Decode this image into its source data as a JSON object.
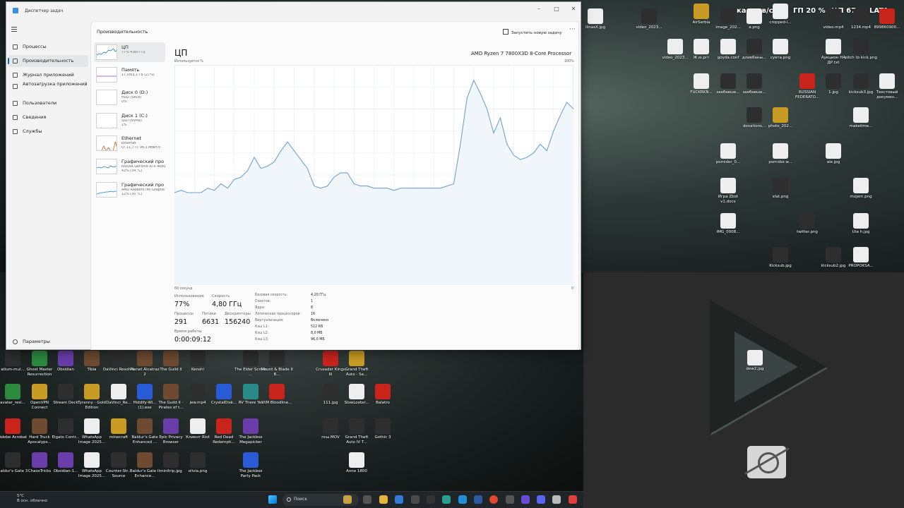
{
  "window": {
    "title": "Диспетчер задач",
    "header": "Производительность",
    "new_task": "Запустить новую задачу",
    "more": "···",
    "minimize": "–",
    "maximize": "□",
    "close": "✕"
  },
  "nav": {
    "items": [
      {
        "label": "Процессы",
        "icon": "processes-icon"
      },
      {
        "label": "Производительность",
        "icon": "performance-icon",
        "selected": true
      },
      {
        "label": "Журнал приложений",
        "icon": "app-history-icon"
      },
      {
        "label": "Автозагрузка приложений",
        "icon": "startup-icon"
      },
      {
        "label": "Пользователи",
        "icon": "users-icon"
      },
      {
        "label": "Сведения",
        "icon": "details-icon"
      },
      {
        "label": "Службы",
        "icon": "services-icon"
      }
    ],
    "settings": "Параметры"
  },
  "devices": [
    {
      "name": "ЦП",
      "line1": "77% 4,80 ГГц",
      "line2": "",
      "selected": true
    },
    {
      "name": "Память",
      "line1": "17,0/63,1 ГБ (27%)",
      "line2": ""
    },
    {
      "name": "Диск 0 (D:)",
      "line1": "HDD (SATA)",
      "line2": "0%"
    },
    {
      "name": "Диск 1 (C:)",
      "line1": "SSD (NVMe)",
      "line2": "1%"
    },
    {
      "name": "Ethernet",
      "line1": "Ethernet",
      "line2": "О: 11,7 П: 98,3 Мбит/с"
    },
    {
      "name": "Графический про",
      "line1": "NVIDIA GeForce RTX 4080",
      "line2": "43% (34 °C)"
    },
    {
      "name": "Графический про",
      "line1": "AMD Radeon(TM) Graphics",
      "line2": "12% (30 °C)"
    }
  ],
  "cpu": {
    "title": "ЦП",
    "name": "AMD Ryzen 7 7800X3D 8-Core Processor",
    "util_label": "Используется %",
    "max_label": "100%",
    "time_label": "60 секунд",
    "zero_label": "0",
    "stats": {
      "usage_label": "Использование",
      "usage": "77%",
      "speed_label": "Скорость",
      "speed": "4,80 ГГц",
      "procs_label": "Процессы",
      "procs": "291",
      "threads_label": "Потоки",
      "threads": "6631",
      "handles_label": "Дескрипторы",
      "handles": "156240",
      "uptime_label": "Время работы",
      "uptime": "0:00:09:12"
    },
    "specs": [
      {
        "k": "Базовая скорость:",
        "v": "4,20 ГГц"
      },
      {
        "k": "Сокетов:",
        "v": "1"
      },
      {
        "k": "Ядра:",
        "v": "8"
      },
      {
        "k": "Логических процессоров:",
        "v": "16"
      },
      {
        "k": "Виртуализация:",
        "v": "Включено"
      },
      {
        "k": "Кэш L1:",
        "v": "512 КБ"
      },
      {
        "k": "Кэш L2:",
        "v": "8,0 МБ"
      },
      {
        "k": "Кэш L3:",
        "v": "96,0 МБ"
      }
    ]
  },
  "chart_data": {
    "type": "area",
    "title": "ЦП",
    "ylabel": "Используется %",
    "xlabel": "60 секунд",
    "ylim": [
      0,
      100
    ],
    "x": [
      60,
      59,
      58,
      57,
      56,
      55,
      54,
      53,
      52,
      51,
      50,
      49,
      48,
      47,
      46,
      45,
      44,
      43,
      42,
      41,
      40,
      39,
      38,
      37,
      36,
      35,
      34,
      33,
      32,
      31,
      30,
      29,
      28,
      27,
      26,
      25,
      24,
      23,
      22,
      21,
      20,
      19,
      18,
      17,
      16,
      15,
      14,
      13,
      12,
      11,
      10,
      9,
      8,
      7,
      6,
      5,
      4,
      3,
      2,
      1,
      0
    ],
    "series": [
      {
        "values": [
          42,
          43,
          42,
          42,
          42,
          44,
          43,
          46,
          44,
          48,
          49,
          52,
          58,
          53,
          54,
          56,
          61,
          65,
          61,
          57,
          53,
          45,
          44,
          45,
          49,
          51,
          51,
          46,
          45,
          45,
          44,
          44,
          44,
          43,
          44,
          44,
          44,
          44,
          44,
          44,
          44,
          45,
          46,
          64,
          85,
          93,
          87,
          80,
          69,
          76,
          64,
          59,
          57,
          58,
          60,
          64,
          61,
          70,
          77,
          83,
          80
        ]
      }
    ]
  },
  "desktop": {
    "tray_top": [
      {
        "text": "кадров/с"
      },
      {
        "text": "ГП 20 %"
      },
      {
        "text": "ЦП 67"
      },
      {
        "text": "LATA"
      }
    ],
    "top_icons": [
      {
        "label": "ilinasX.jpg",
        "color": "white"
      },
      {
        "label": "video_2023...",
        "color": "dark"
      },
      {
        "label": "AirSerbia",
        "color": "gold"
      },
      {
        "label": "image_202...",
        "color": "dark"
      },
      {
        "label": "a.png",
        "color": "white"
      },
      {
        "label": "cropped-i...",
        "color": "white"
      },
      {
        "label": "video.mp4",
        "color": "dark"
      },
      {
        "label": "1234.mp4",
        "color": "dark"
      },
      {
        "label": "899860900...",
        "color": "red"
      },
      {
        "label": "video_2023...",
        "color": "white"
      },
      {
        "label": "Ж.ю.ргг",
        "color": "white"
      },
      {
        "label": "goyda.conf",
        "color": "white"
      },
      {
        "label": "длиебаны...",
        "color": "dark"
      },
      {
        "label": "суета.png",
        "color": "white"
      },
      {
        "label": "Аукцион НА ДР.txt",
        "color": "white"
      },
      {
        "label": "pitch to kick.png",
        "color": "dark"
      },
      {
        "label": "FUCKRKN...",
        "color": "white"
      },
      {
        "label": "заебавше...",
        "color": "dark"
      },
      {
        "label": "заебавше...",
        "color": "dark"
      },
      {
        "label": "RUSSIAN FEDERATO...",
        "color": "red"
      },
      {
        "label": "1.jpg",
        "color": "dark"
      },
      {
        "label": "kicksub3.jpg",
        "color": "dark"
      },
      {
        "label": "Текстовый докумен...",
        "color": "white"
      },
      {
        "label": "donations...",
        "color": "dark"
      },
      {
        "label": "photo_202...",
        "color": "gold"
      },
      {
        "label": "makeitme...",
        "color": "white"
      },
      {
        "label": "pomidor_0...",
        "color": "white"
      },
      {
        "label": "pomidor.w...",
        "color": "white"
      },
      {
        "label": "ale.jpg",
        "color": "white"
      },
      {
        "label": "Игра Zbot v1.docx",
        "color": "white"
      },
      {
        "label": "stat.png",
        "color": "dark"
      },
      {
        "label": "mojem.png",
        "color": "white"
      },
      {
        "label": "IMG_0008...",
        "color": "white"
      },
      {
        "label": "twitter.png",
        "color": "dark"
      },
      {
        "label": "Ute h.jpg",
        "color": "white"
      },
      {
        "label": "Kicksub.jpg",
        "color": "dark"
      },
      {
        "label": "kicksub2.jpg",
        "color": "dark"
      },
      {
        "label": "PROPOKSA...",
        "color": "white"
      }
    ],
    "bottom_icons": [
      {
        "label": "atium-mul...",
        "color": "dark"
      },
      {
        "label": "Ghost Master Resurrection",
        "color": "green"
      },
      {
        "label": "Obsidian",
        "color": "purple"
      },
      {
        "label": "Tibia",
        "color": "brown"
      },
      {
        "label": "DaVinci Resolve",
        "color": "dark"
      },
      {
        "label": "Planet Alcatraz 2",
        "color": "brown"
      },
      {
        "label": "The Guild II",
        "color": "brown"
      },
      {
        "label": "Kenshi",
        "color": "dark"
      },
      {
        "label": "The Elder Scrolls ...",
        "color": "dark"
      },
      {
        "label": "Mount & Blade II B...",
        "color": "dark"
      },
      {
        "label": "Crusader Kings III",
        "color": "red"
      },
      {
        "label": "Grand Theft Auto - Sa...",
        "color": "gold"
      },
      {
        "label": "avatar_resi...",
        "color": "green"
      },
      {
        "label": "OpenVPN Connect",
        "color": "gold"
      },
      {
        "label": "Stream Deck",
        "color": "dark"
      },
      {
        "label": "Tyranny - Gold Edition",
        "color": "gold"
      },
      {
        "label": "DaVinci_Re...",
        "color": "white"
      },
      {
        "label": "Hiddify-Wi... (1).exe",
        "color": "blue"
      },
      {
        "label": "The Guild II - Pirates of t...",
        "color": "brown"
      },
      {
        "label": "jew.mp4",
        "color": "dark"
      },
      {
        "label": "CrystalDisk...",
        "color": "blue"
      },
      {
        "label": "RV There Yet",
        "color": "teal"
      },
      {
        "label": "VtM Bloodline...",
        "color": "red"
      },
      {
        "label": "111.jpg",
        "color": "dark"
      },
      {
        "label": "SlowLooter...",
        "color": "white"
      },
      {
        "label": "Balatro",
        "color": "red"
      },
      {
        "label": "Adobe Acrobat",
        "color": "red"
      },
      {
        "label": "Hard Truck Apocalyps...",
        "color": "brown"
      },
      {
        "label": "Elgato Contr...",
        "color": "dark"
      },
      {
        "label": "WhatsApp Image 2025...",
        "color": "white"
      },
      {
        "label": "minecraft",
        "color": "gold"
      },
      {
        "label": "Baldur's Gate Enhanced ...",
        "color": "brown"
      },
      {
        "label": "Epic Privacy Browser",
        "color": "purple"
      },
      {
        "label": "Клиент Riot",
        "color": "white"
      },
      {
        "label": "Red Dead Redempti...",
        "color": "red"
      },
      {
        "label": "The Jackbox Megapicker",
        "color": "purple"
      },
      {
        "label": "псы.MOV",
        "color": "dark"
      },
      {
        "label": "Grand Theft Auto IV T...",
        "color": "dark"
      },
      {
        "label": "Gothic 3",
        "color": "dark"
      },
      {
        "label": "Baldur's Gate 3",
        "color": "dark"
      },
      {
        "label": "ChaosTricks",
        "color": "purple"
      },
      {
        "label": "Obsidian-1...",
        "color": "purple"
      },
      {
        "label": "WhatsApp Image 2025...",
        "color": "white"
      },
      {
        "label": "Counter-Str... Source",
        "color": "dark"
      },
      {
        "label": "Baldur's Gate II Enhance...",
        "color": "brown"
      },
      {
        "label": "minitrip.jpg",
        "color": "dark"
      },
      {
        "label": "olivia.png",
        "color": "dark"
      },
      {
        "label": "The Jackbox Party Pack",
        "color": "blue"
      },
      {
        "label": "Anno 1800",
        "color": "white"
      }
    ],
    "right_icons": [
      {
        "label": "dew2.jpg",
        "color": "white"
      }
    ]
  },
  "taskbar": {
    "weather_temp": "5°C",
    "weather_desc": "В осн. облачно",
    "search_placeholder": "Поиск"
  }
}
